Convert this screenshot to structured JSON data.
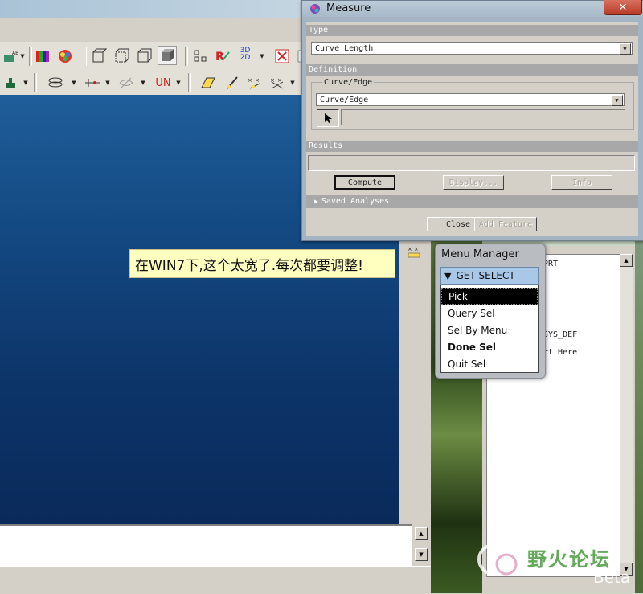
{
  "measure_dialog": {
    "title": "Measure",
    "close_glyph": "✕",
    "type_section": "Type",
    "type_value": "Curve Length",
    "definition_section": "Definition",
    "curve_edge_group": "Curve/Edge",
    "curve_edge_value": "Curve/Edge",
    "results_section": "Results",
    "compute_button": "Compute",
    "display_button": "Display...",
    "info_button": "Info",
    "saved_analyses": "Saved Analyses",
    "close_button": "Close",
    "add_feature_button": "Add Feature"
  },
  "tooltip": {
    "text": "在WIN7下,这个太宽了.每次都要调整!"
  },
  "menu_manager": {
    "title": "Menu Manager",
    "header": "GET SELECT",
    "items": [
      {
        "label": "Pick",
        "state": "selected"
      },
      {
        "label": "Query Sel",
        "state": "normal"
      },
      {
        "label": "Sel By Menu",
        "state": "normal"
      },
      {
        "label": "Done Sel",
        "state": "bold"
      },
      {
        "label": "Quit Sel",
        "state": "normal"
      }
    ]
  },
  "model_tree": {
    "lines": [
      "PRT",
      "SYS_DEF",
      "rt Here"
    ]
  },
  "toolbar": {
    "icons": [
      "layer-icon",
      "color-appearance-icon",
      "view-orient-icon",
      "wireframe-icon",
      "hidden-line-icon",
      "no-hidden-icon",
      "shading-icon",
      "datum-points-icon",
      "regenerate-icon",
      "3d-2d-icon",
      "close-window-icon",
      "query-icon"
    ],
    "units_label": "UN",
    "dim_3d_label": "3D",
    "dim_2d_label": "2D"
  },
  "watermark": {
    "text": "野火论坛",
    "badge": "Beta"
  },
  "colors": {
    "graphics_top": "#1f5e9a",
    "graphics_bottom": "#0a2a5a",
    "tooltip_bg": "#ffffc0",
    "menu_header": "#a9c7e6",
    "dialog_frame": "#a4b4c3"
  }
}
